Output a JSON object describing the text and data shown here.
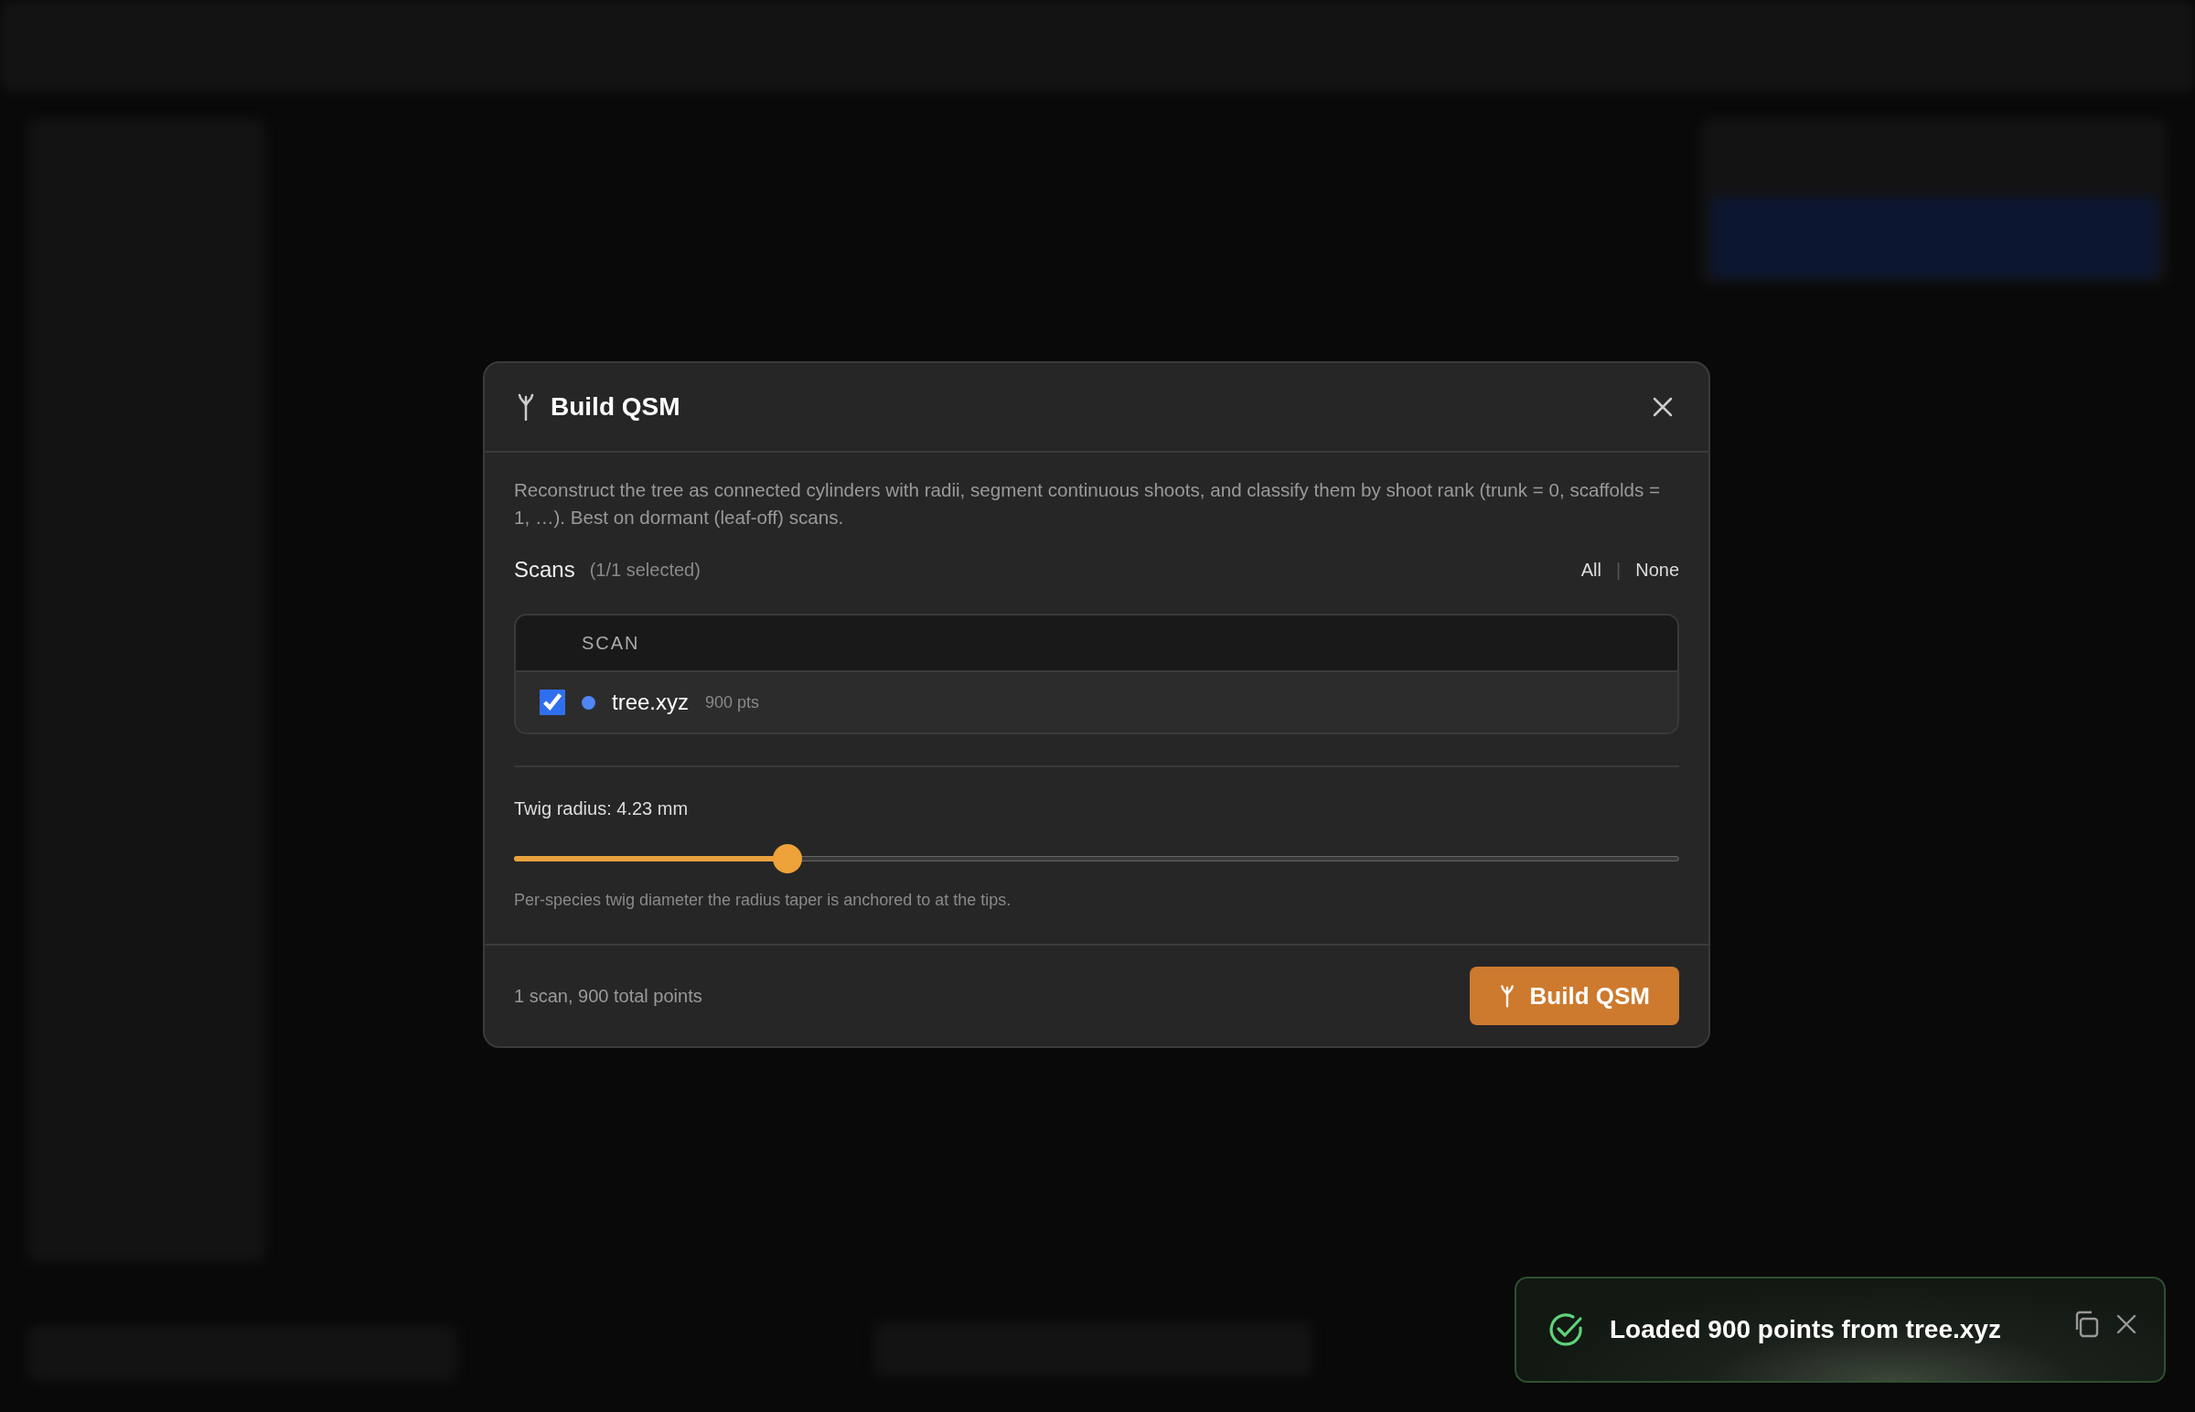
{
  "dialog": {
    "title": "Build QSM",
    "description": "Reconstruct the tree as connected cylinders with radii, segment continuous shoots, and classify them by shoot rank (trunk = 0, scaffolds = 1, …). Best on dormant (leaf-off) scans.",
    "scans_label": "Scans",
    "selection_count": "(1/1 selected)",
    "select_all": "All",
    "separator": "|",
    "select_none": "None",
    "table": {
      "columns": [
        "SCAN"
      ],
      "rows": [
        {
          "checked": true,
          "color": "#4f86f7",
          "name": "tree.xyz",
          "points": "900 pts"
        }
      ]
    },
    "slider": {
      "label": "Twig radius: 4.23 mm",
      "level": 0.235,
      "hint": "Per-species twig diameter the radius taper is anchored to at the tips."
    },
    "summary": "1 scan, 900 total points",
    "primary_button": "Build QSM"
  },
  "toast": {
    "kind": "success",
    "message": "Loaded 900 points from tree.xyz"
  }
}
